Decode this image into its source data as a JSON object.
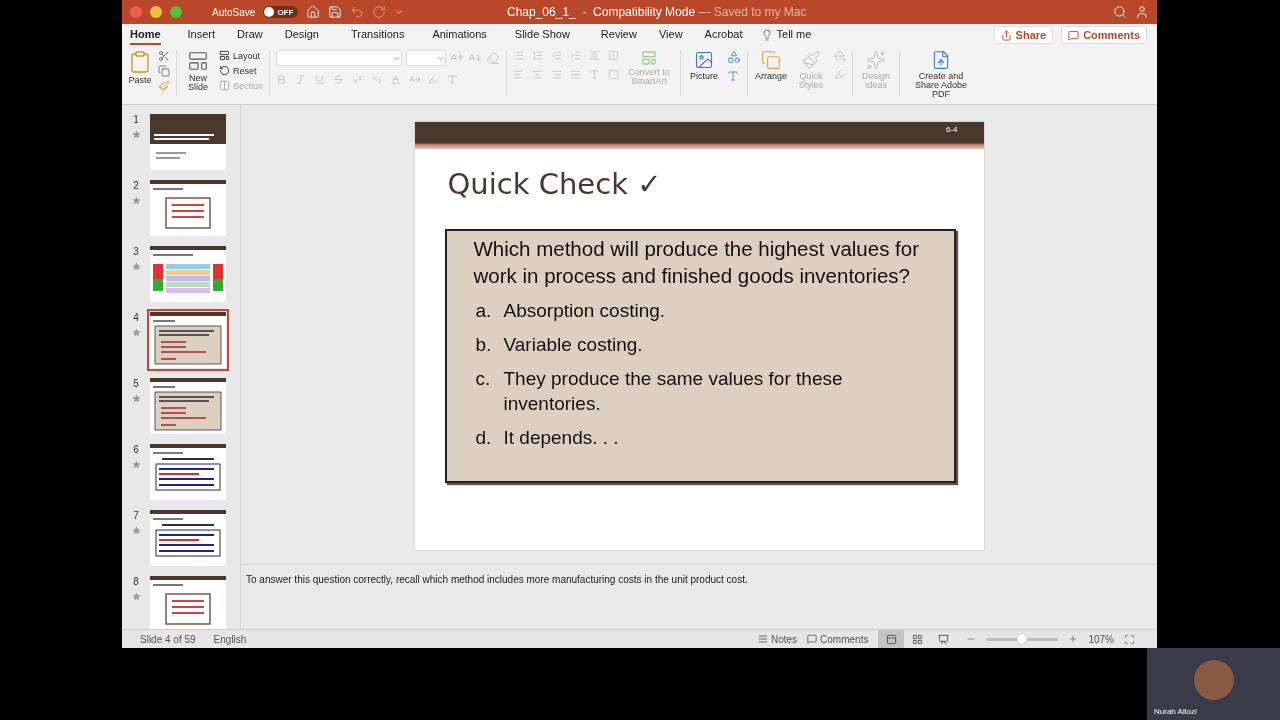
{
  "window": {
    "title": "Chap_06_1_  -  Compatibility Mode",
    "save_status": "— Saved to my Mac",
    "autosave": {
      "label": "AutoSave",
      "toggle_text": "OFF",
      "on": false
    }
  },
  "tabs": [
    {
      "label": "Home",
      "selected": true
    },
    {
      "label": "Insert",
      "selected": false
    },
    {
      "label": "Draw",
      "selected": false
    },
    {
      "label": "Design",
      "selected": false
    },
    {
      "label": "Transitions",
      "selected": false
    },
    {
      "label": "Animations",
      "selected": false
    },
    {
      "label": "Slide Show",
      "selected": false
    },
    {
      "label": "Review",
      "selected": false
    },
    {
      "label": "View",
      "selected": false
    },
    {
      "label": "Acrobat",
      "selected": false
    }
  ],
  "tell_me": "Tell me",
  "share_button": "Share",
  "comments_button": "Comments",
  "ribbon": {
    "paste": {
      "label": "Paste",
      "disabled": false
    },
    "new_slide": {
      "label": "New Slide",
      "disabled": false
    },
    "layout": {
      "label": "Layout",
      "disabled": false
    },
    "reset": {
      "label": "Reset",
      "disabled": false
    },
    "section": {
      "label": "Section",
      "disabled": true
    },
    "convert": {
      "label": "Convert to SmartArt",
      "disabled": true
    },
    "picture": {
      "label": "Picture",
      "disabled": false
    },
    "arrange": {
      "label": "Arrange",
      "disabled": false
    },
    "quick_styles": {
      "label": "Quick Styles",
      "disabled": true
    },
    "design_ideas": {
      "label": "Design Ideas",
      "disabled": true
    },
    "adobe_pdf": {
      "label": "Create and Share Adobe PDF",
      "disabled": false
    }
  },
  "slides": [
    {
      "number": "1",
      "kind": "title",
      "selected": false
    },
    {
      "number": "2",
      "kind": "objective",
      "selected": false
    },
    {
      "number": "3",
      "kind": "table",
      "selected": false
    },
    {
      "number": "4",
      "kind": "quiz",
      "selected": true
    },
    {
      "number": "5",
      "kind": "quiz",
      "selected": false
    },
    {
      "number": "6",
      "kind": "blue-table",
      "selected": false
    },
    {
      "number": "7",
      "kind": "blue-table",
      "selected": false
    },
    {
      "number": "8",
      "kind": "objective",
      "selected": false
    }
  ],
  "slide": {
    "header_number": "6-4",
    "title": "Quick Check ✓",
    "question": "Which method will produce the highest values for work in process and finished goods inventories?",
    "options": [
      {
        "letter": "a.",
        "text": "Absorption costing."
      },
      {
        "letter": "b.",
        "text": "Variable costing."
      },
      {
        "letter": "c.",
        "text": "They produce the same values for these inventories."
      },
      {
        "letter": "d.",
        "text": "It depends. . ."
      }
    ]
  },
  "notes": "To answer this question correctly, recall which method includes more manufacturing costs in the unit product cost.",
  "status_bar": {
    "slide_position": "Slide 4 of 59",
    "language": "English",
    "notes": "Notes",
    "comments": "Comments",
    "views": [
      {
        "kind": "normal",
        "selected": true
      },
      {
        "kind": "sorter",
        "selected": false
      },
      {
        "kind": "reading",
        "selected": false
      }
    ],
    "zoom": {
      "level": 0.5,
      "reading": "107%"
    }
  },
  "participant": {
    "name": "Nurah Allozi"
  }
}
